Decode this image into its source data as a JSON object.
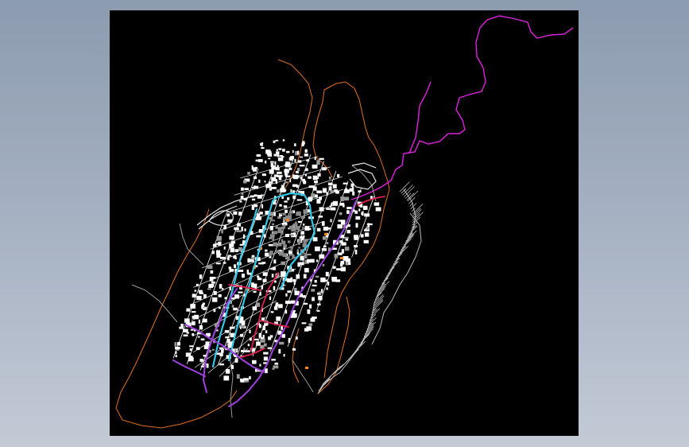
{
  "drawing": {
    "background": "#000000",
    "colors": {
      "boundary": "#e07020",
      "river": "#e020e0",
      "arterial": "#30c8e8",
      "secondary_road": "#a040e0",
      "red_road": "#e02050",
      "grid_road": "#e6e6e6",
      "buildings": "#ffffff",
      "hatch": "#b8b8b8",
      "orange_block": "#ff8820",
      "gray_line": "#9a9a9a"
    }
  }
}
